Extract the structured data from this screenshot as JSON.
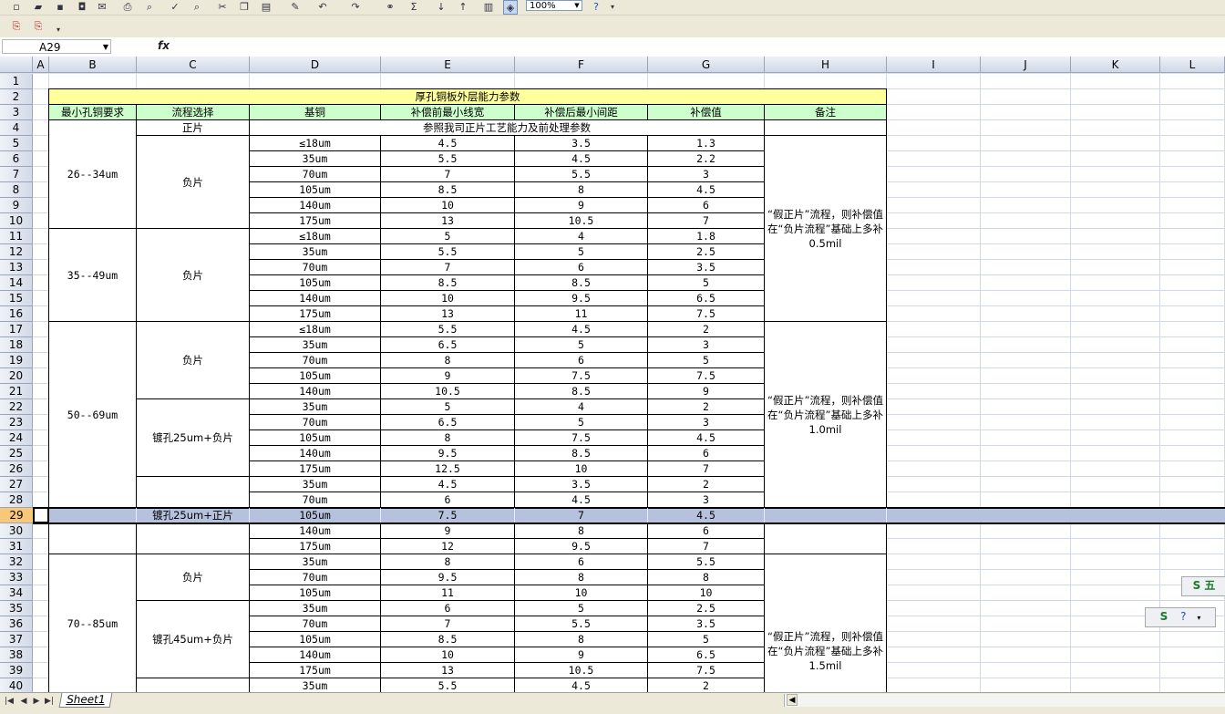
{
  "toolbar": {
    "zoom_value": "100%",
    "sum_symbol": "Σ",
    "help_symbol": "?"
  },
  "formula_bar": {
    "name_box": "A29",
    "fx_label": "fx",
    "formula_value": ""
  },
  "columns": [
    "A",
    "B",
    "C",
    "D",
    "E",
    "F",
    "G",
    "H",
    "I",
    "J",
    "K",
    "L"
  ],
  "rows": [
    "1",
    "2",
    "3",
    "4",
    "5",
    "6",
    "7",
    "8",
    "9",
    "10",
    "11",
    "12",
    "13",
    "14",
    "15",
    "16",
    "17",
    "18",
    "19",
    "20",
    "21",
    "22",
    "23",
    "24",
    "25",
    "26",
    "27",
    "28",
    "29",
    "30",
    "31",
    "32",
    "33",
    "34",
    "35",
    "36",
    "37",
    "38",
    "39",
    "40"
  ],
  "selected_row": "29",
  "table": {
    "title": "厚孔铜板外层能力参数",
    "headers": [
      "最小孔铜要求",
      "流程选择",
      "基铜",
      "补偿前最小线宽",
      "补偿后最小间距",
      "补偿值",
      "备注"
    ],
    "positive_row": {
      "process": "正片",
      "note": "参照我司正片工艺能力及前处理参数"
    },
    "groups": [
      {
        "label": "26--34um"
      },
      {
        "label": "35--49um"
      },
      {
        "label": "50--69um"
      },
      {
        "label": "70--85um"
      }
    ],
    "process_labels": {
      "neg": "负片",
      "neg2": "负片",
      "neg3": "负片",
      "plate25_neg": "镀孔25um+负片",
      "plate25_pos": "镀孔25um+正片",
      "neg4": "负片",
      "plate45_neg": "镀孔45um+负片"
    },
    "remarks": {
      "r1": "“假正片”流程，则补偿值在“负片流程”基础上多补0.5mil",
      "r2": "“假正片”流程，则补偿值在“负片流程”基础上多补1.0mil",
      "r3": "“假正片”流程，则补偿值在“负片流程”基础上多补1.5mil"
    },
    "data_rows": [
      {
        "row": 5,
        "d": "≤18um",
        "e": "4.5",
        "f": "3.5",
        "g": "1.3"
      },
      {
        "row": 6,
        "d": "35um",
        "e": "5.5",
        "f": "4.5",
        "g": "2.2"
      },
      {
        "row": 7,
        "d": "70um",
        "e": "7",
        "f": "5.5",
        "g": "3"
      },
      {
        "row": 8,
        "d": "105um",
        "e": "8.5",
        "f": "8",
        "g": "4.5"
      },
      {
        "row": 9,
        "d": "140um",
        "e": "10",
        "f": "9",
        "g": "6"
      },
      {
        "row": 10,
        "d": "175um",
        "e": "13",
        "f": "10.5",
        "g": "7"
      },
      {
        "row": 11,
        "d": "≤18um",
        "e": "5",
        "f": "4",
        "g": "1.8"
      },
      {
        "row": 12,
        "d": "35um",
        "e": "5.5",
        "f": "5",
        "g": "2.5"
      },
      {
        "row": 13,
        "d": "70um",
        "e": "7",
        "f": "6",
        "g": "3.5"
      },
      {
        "row": 14,
        "d": "105um",
        "e": "8.5",
        "f": "8.5",
        "g": "5"
      },
      {
        "row": 15,
        "d": "140um",
        "e": "10",
        "f": "9.5",
        "g": "6.5"
      },
      {
        "row": 16,
        "d": "175um",
        "e": "13",
        "f": "11",
        "g": "7.5"
      },
      {
        "row": 17,
        "d": "≤18um",
        "e": "5.5",
        "f": "4.5",
        "g": "2"
      },
      {
        "row": 18,
        "d": "35um",
        "e": "6.5",
        "f": "5",
        "g": "3"
      },
      {
        "row": 19,
        "d": "70um",
        "e": "8",
        "f": "6",
        "g": "5"
      },
      {
        "row": 20,
        "d": "105um",
        "e": "9",
        "f": "7.5",
        "g": "7.5"
      },
      {
        "row": 21,
        "d": "140um",
        "e": "10.5",
        "f": "8.5",
        "g": "9"
      },
      {
        "row": 22,
        "d": "35um",
        "e": "5",
        "f": "4",
        "g": "2"
      },
      {
        "row": 23,
        "d": "70um",
        "e": "6.5",
        "f": "5",
        "g": "3"
      },
      {
        "row": 24,
        "d": "105um",
        "e": "8",
        "f": "7.5",
        "g": "4.5"
      },
      {
        "row": 25,
        "d": "140um",
        "e": "9.5",
        "f": "8.5",
        "g": "6"
      },
      {
        "row": 26,
        "d": "175um",
        "e": "12.5",
        "f": "10",
        "g": "7"
      },
      {
        "row": 27,
        "d": "35um",
        "e": "4.5",
        "f": "3.5",
        "g": "2"
      },
      {
        "row": 28,
        "d": "70um",
        "e": "6",
        "f": "4.5",
        "g": "3"
      },
      {
        "row": 29,
        "d": "105um",
        "e": "7.5",
        "f": "7",
        "g": "4.5"
      },
      {
        "row": 30,
        "d": "140um",
        "e": "9",
        "f": "8",
        "g": "6"
      },
      {
        "row": 31,
        "d": "175um",
        "e": "12",
        "f": "9.5",
        "g": "7"
      },
      {
        "row": 32,
        "d": "35um",
        "e": "8",
        "f": "6",
        "g": "5.5"
      },
      {
        "row": 33,
        "d": "70um",
        "e": "9.5",
        "f": "8",
        "g": "8"
      },
      {
        "row": 34,
        "d": "105um",
        "e": "11",
        "f": "10",
        "g": "10"
      },
      {
        "row": 35,
        "d": "35um",
        "e": "6",
        "f": "5",
        "g": "2.5"
      },
      {
        "row": 36,
        "d": "70um",
        "e": "7",
        "f": "5.5",
        "g": "3.5"
      },
      {
        "row": 37,
        "d": "105um",
        "e": "8.5",
        "f": "8",
        "g": "5"
      },
      {
        "row": 38,
        "d": "140um",
        "e": "10",
        "f": "9",
        "g": "6.5"
      },
      {
        "row": 39,
        "d": "175um",
        "e": "13",
        "f": "10.5",
        "g": "7.5"
      },
      {
        "row": 40,
        "d": "35um",
        "e": "5.5",
        "f": "4.5",
        "g": "2"
      }
    ]
  },
  "sheet_tab": "Sheet1",
  "floating": {
    "ime_label": "五",
    "ime_icon": "S"
  }
}
